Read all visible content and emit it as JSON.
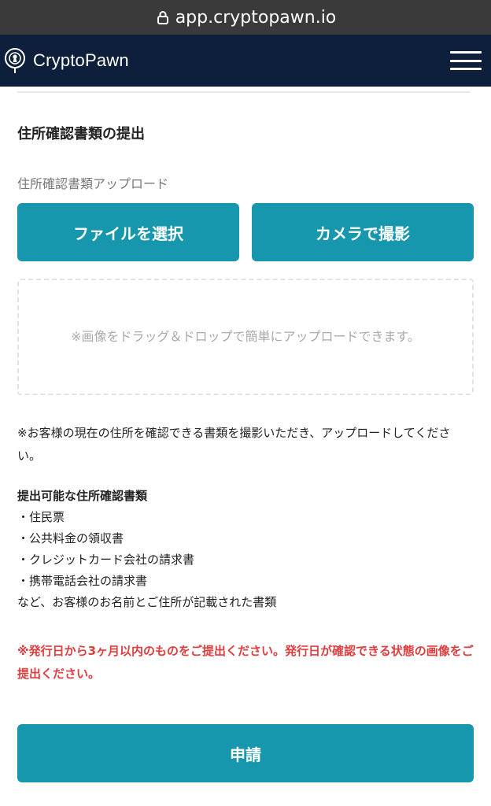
{
  "browser": {
    "url": "app.cryptopawn.io",
    "lock_icon": "lock-icon"
  },
  "header": {
    "brand_name": "CryptoPawn",
    "logo_icon": "pawn-logo-icon",
    "menu_icon": "hamburger-menu-icon"
  },
  "form": {
    "title": "住所確認書類の提出",
    "upload_label": "住所確認書類アップロード",
    "select_file_label": "ファイルを選択",
    "camera_label": "カメラで撮影",
    "dropzone_text": "※画像をドラッグ＆ドロップで簡単にアップロードできます。",
    "notice": "※お客様の現在の住所を確認できる書類を撮影いただき、アップロードしてください。",
    "docs_title": "提出可能な住所確認書類",
    "docs": [
      "住民票",
      "公共料金の領収書",
      "クレジットカード会社の請求書",
      "携帯電話会社の請求書"
    ],
    "docs_tail": "など、お客様のお名前とご住所が記載された書類",
    "warning": "※発行日から3ヶ月以内のものをご提出ください。発行日が確認できる状態の画像をご提出ください。",
    "submit_label": "申請"
  },
  "colors": {
    "accent": "#1797ad",
    "header_bg": "#0d1f3a",
    "warning": "#e03d3d"
  }
}
